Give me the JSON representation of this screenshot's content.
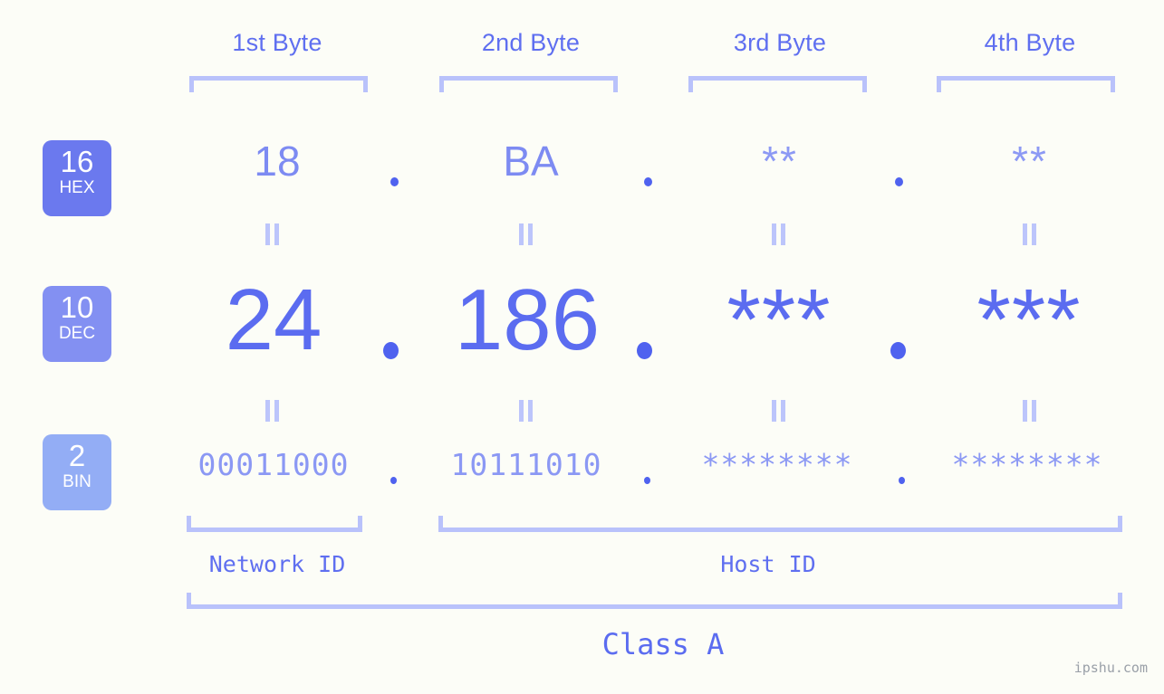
{
  "theme": {
    "background": "#fcfdf7",
    "accent_strong": "#5b6cf0",
    "accent_mid": "#7d8bf2",
    "accent_light": "#b9c2fb",
    "badge_hex": "#6b79ee",
    "badge_dec": "#8390f2",
    "badge_bin": "#93adf5",
    "watermark_color": "#9aa0a8"
  },
  "byte_headers": [
    {
      "label": "1st Byte"
    },
    {
      "label": "2nd Byte"
    },
    {
      "label": "3rd Byte"
    },
    {
      "label": "4th Byte"
    }
  ],
  "bases": [
    {
      "number": "16",
      "name": "HEX"
    },
    {
      "number": "10",
      "name": "DEC"
    },
    {
      "number": "2",
      "name": "BIN"
    }
  ],
  "rows": {
    "hex": {
      "base_number": "16",
      "base_name": "HEX",
      "values": [
        "18",
        "BA",
        "**",
        "**"
      ],
      "separator": "."
    },
    "dec": {
      "base_number": "10",
      "base_name": "DEC",
      "values": [
        "24",
        "186",
        "***",
        "***"
      ],
      "separator": "."
    },
    "bin": {
      "base_number": "2",
      "base_name": "BIN",
      "values": [
        "00011000",
        "10111010",
        "********",
        "********"
      ],
      "separator": "."
    }
  },
  "segments": {
    "network_id": "Network ID",
    "host_id": "Host ID"
  },
  "class_label": "Class A",
  "watermark": "ipshu.com"
}
